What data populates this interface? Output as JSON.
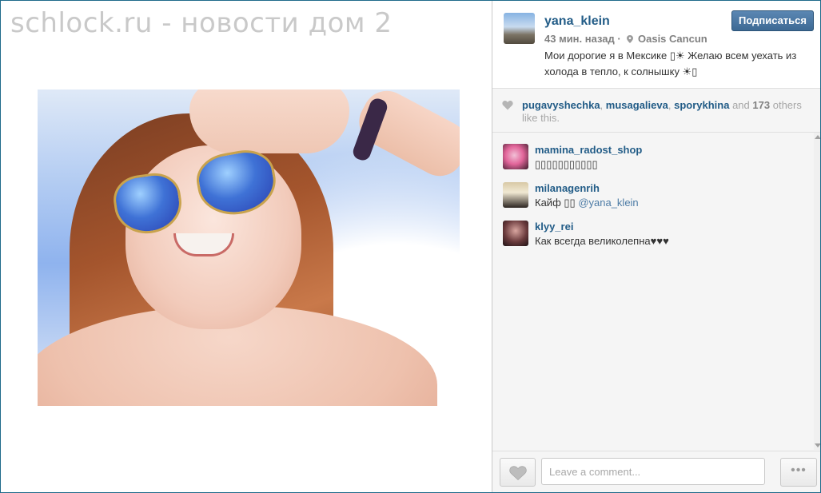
{
  "watermark": "schlock.ru - новости дом 2",
  "post": {
    "username": "yana_klein",
    "time_ago": "43 мин. назад",
    "location_separator": "·",
    "location": "Oasis Cancun",
    "caption": "Мои дорогие я в Мексике ▯☀ Желаю всем уехать из холода в тепло, к солнышку ☀▯",
    "follow_label": "Подписаться"
  },
  "likes": {
    "users": [
      "pugavyshechka",
      "musagalieva",
      "sporykhina"
    ],
    "separator": ",",
    "and_text": "and",
    "count": "173",
    "others_text": "others like this."
  },
  "comments": [
    {
      "username": "mamina_radost_shop",
      "text": "▯▯▯▯▯▯▯▯▯▯▯",
      "mention": ""
    },
    {
      "username": "milanagenrih",
      "text": "Кайф ▯▯",
      "mention": "@yana_klein"
    },
    {
      "username": "klyy_rei",
      "text": "Как всегда великолепна♥♥♥",
      "mention": ""
    }
  ],
  "footer": {
    "comment_placeholder": "Leave a comment...",
    "more_label": "•••"
  },
  "icons": {
    "like": "heart-icon",
    "location": "map-pin-icon",
    "more": "ellipsis-icon"
  },
  "colors": {
    "link": "#225c87",
    "follow_button": "#3d6994",
    "frame_border": "#1f6a8a"
  }
}
